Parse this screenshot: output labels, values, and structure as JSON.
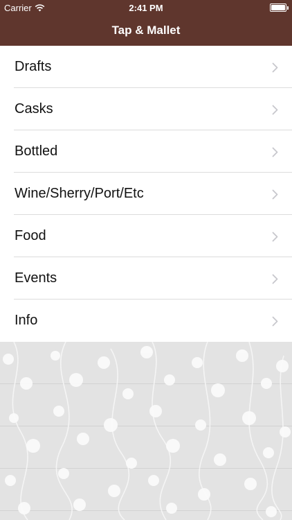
{
  "status_bar": {
    "carrier": "Carrier",
    "time": "2:41 PM",
    "battery_level": 1.0
  },
  "nav": {
    "title": "Tap & Mallet"
  },
  "menu": {
    "items": [
      {
        "label": "Drafts"
      },
      {
        "label": "Casks"
      },
      {
        "label": "Bottled"
      },
      {
        "label": "Wine/Sherry/Port/Etc"
      },
      {
        "label": "Food"
      },
      {
        "label": "Events"
      },
      {
        "label": "Info"
      }
    ]
  },
  "colors": {
    "header_bg": "#5f362d",
    "wallpaper_bg": "#e3e3e3",
    "chevron": "#c7c7cc"
  },
  "icons": {
    "wifi": "wifi-icon",
    "battery": "battery-icon",
    "chevron": "chevron-right-icon"
  }
}
